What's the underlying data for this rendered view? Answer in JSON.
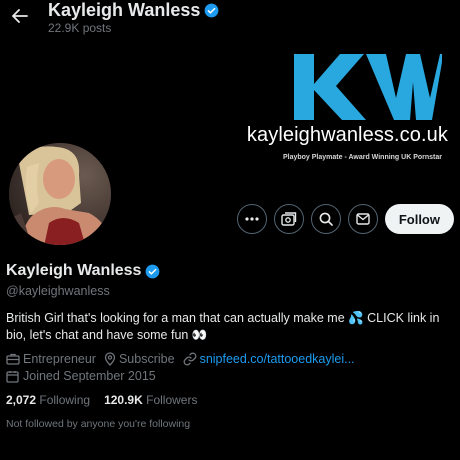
{
  "header": {
    "back_icon": "arrow-left-icon",
    "name": "Kayleigh Wanless",
    "posts": "22.9K posts"
  },
  "banner": {
    "logo_text": "KW",
    "website": "kayleighwanless.co.uk",
    "tagline": "Playboy Playmate - Award Winning UK Pornstar",
    "logo_color": "#29a8e0"
  },
  "actions": {
    "more_icon": "more-icon",
    "subscribe_icon": "subscribe-icon",
    "search_icon": "search-icon",
    "message_icon": "envelope-icon",
    "follow_label": "Follow"
  },
  "profile": {
    "name": "Kayleigh Wanless",
    "handle": "@kayleighwanless",
    "bio": "British Girl that's looking for a man that can actually make me 💦 CLICK link in bio, let's chat and have some fun 👀",
    "category": "Entrepreneur",
    "subscribe": "Subscribe",
    "link": "snipfeed.co/tattooedkaylei...",
    "joined": "Joined September 2015",
    "following_count": "2,072",
    "following_label": "Following",
    "followers_count": "120.9K",
    "followers_label": "Followers",
    "followed_by": "Not followed by anyone you're following"
  },
  "colors": {
    "accent": "#1d9bf0",
    "muted": "#71767b",
    "text": "#e7e9ea",
    "background": "#000000"
  }
}
